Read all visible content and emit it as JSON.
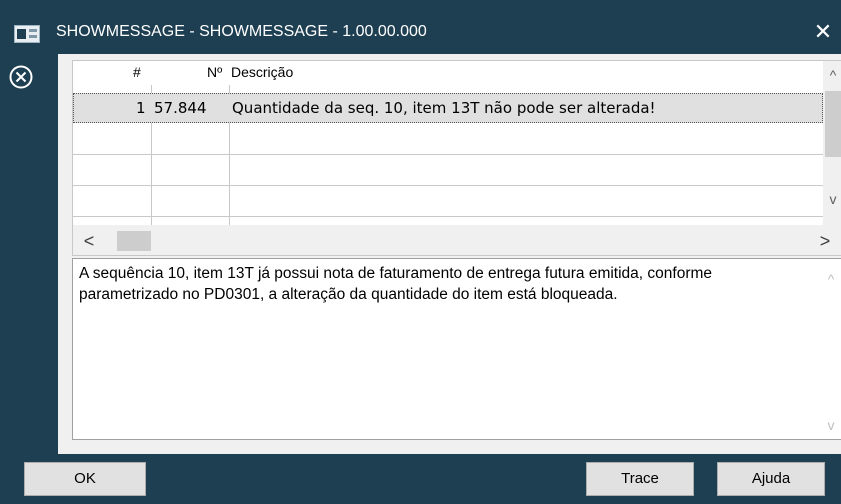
{
  "window": {
    "title": "SHOWMESSAGE - SHOWMESSAGE - 1.00.00.000",
    "close_glyph": "✕",
    "icon": "app-window-icon"
  },
  "status_icon": {
    "name": "error-circle-x-icon",
    "color": "#ffffff"
  },
  "grid": {
    "columns": [
      "#",
      "Nº",
      "Descrição"
    ],
    "rows": [
      {
        "index": "1",
        "number": "57.844",
        "description": "Quantidade da seq. 10, item 13T não pode ser alterada!"
      }
    ],
    "scroll": {
      "up": "^",
      "down": "v",
      "left": "<",
      "right": ">"
    }
  },
  "details": {
    "text": "A sequência 10, item 13T já possui nota de faturamento de entrega futura emitida, conforme parametrizado no PD0301, a alteração da quantidade do item está bloqueada."
  },
  "buttons": {
    "ok": "OK",
    "trace": "Trace",
    "help": "Ajuda"
  },
  "colors": {
    "chrome": "#1e3f52",
    "selected_row": "#e0e0e0",
    "button": "#e1e1e1"
  }
}
